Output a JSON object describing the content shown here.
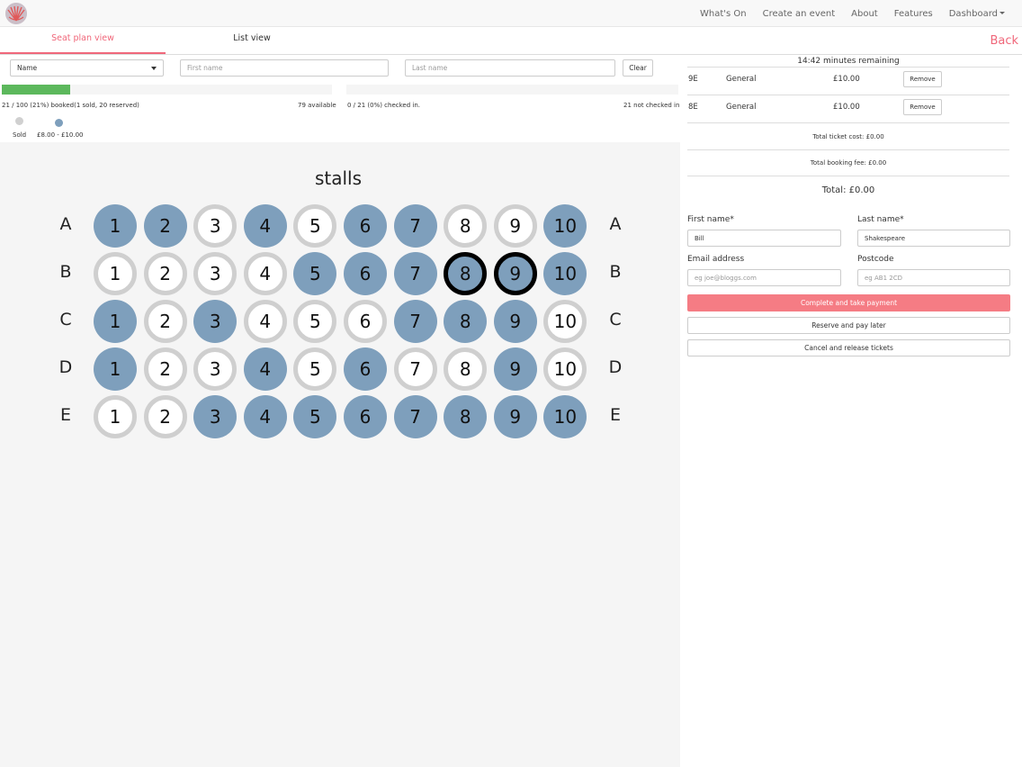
{
  "nav": {
    "items": [
      {
        "label": "What's On"
      },
      {
        "label": "Create an event"
      },
      {
        "label": "About"
      },
      {
        "label": "Features"
      },
      {
        "label": "Dashboard"
      }
    ]
  },
  "tabs": {
    "seat_plan": "Seat plan view",
    "list": "List view",
    "back": "Back"
  },
  "search": {
    "field_select": "Name",
    "first_name_placeholder": "First name",
    "last_name_placeholder": "Last name",
    "clear_label": "Clear"
  },
  "booking_stats": {
    "booked_fraction": 0.21,
    "booked_text": "21 / 100 (21%) booked(1 sold, 20 reserved)",
    "available_text": "79 available",
    "checked_in_fraction": 0,
    "checked_in_text": "0 / 21 (0%) checked in.",
    "not_checked_in_text": "21 not checked in"
  },
  "legend": {
    "sold_label": "Sold",
    "sold_color": "#d0d0d0",
    "price_label": "£8.00 - £10.00",
    "price_color": "#7e9fbc"
  },
  "seat_plan": {
    "block_title": "stalls",
    "colors": {
      "booked": "#7e9fbc",
      "free": "#ffffff",
      "free_ring": "#cfcfcf",
      "selected_ring": "#000000"
    },
    "rows": [
      {
        "label": "A",
        "seats": [
          "booked",
          "booked",
          "free",
          "booked",
          "free",
          "booked",
          "booked",
          "free",
          "free",
          "booked"
        ]
      },
      {
        "label": "B",
        "seats": [
          "free",
          "free",
          "free",
          "free",
          "booked",
          "booked",
          "booked",
          "selected",
          "selected",
          "booked"
        ]
      },
      {
        "label": "C",
        "seats": [
          "booked",
          "free",
          "booked",
          "free",
          "free",
          "free",
          "booked",
          "booked",
          "booked",
          "free"
        ]
      },
      {
        "label": "D",
        "seats": [
          "booked",
          "free",
          "free",
          "booked",
          "free",
          "booked",
          "free",
          "free",
          "booked",
          "free"
        ]
      },
      {
        "label": "E",
        "seats": [
          "free",
          "free",
          "booked",
          "booked",
          "booked",
          "booked",
          "booked",
          "booked",
          "booked",
          "booked"
        ]
      }
    ],
    "seat_numbers": [
      "1",
      "2",
      "3",
      "4",
      "5",
      "6",
      "7",
      "8",
      "9",
      "10"
    ]
  },
  "basket": {
    "timer": "14:42 minutes remaining",
    "tickets": [
      {
        "seat": "9E",
        "type": "General",
        "price": "£10.00",
        "remove_label": "Remove"
      },
      {
        "seat": "8E",
        "type": "General",
        "price": "£10.00",
        "remove_label": "Remove"
      }
    ],
    "total_ticket_cost": "Total ticket cost: £0.00",
    "total_booking_fee": "Total booking fee: £0.00",
    "total": "Total: £0.00"
  },
  "form": {
    "first_name_label": "First name*",
    "first_name_value": "Bill",
    "last_name_label": "Last name*",
    "last_name_value": "Shakespeare",
    "email_label": "Email address",
    "email_placeholder": "eg joe@bloggs.com",
    "postcode_label": "Postcode",
    "postcode_placeholder": "eg AB1 2CD"
  },
  "actions": {
    "complete": "Complete and take payment",
    "reserve": "Reserve and pay later",
    "cancel": "Cancel and release tickets"
  }
}
